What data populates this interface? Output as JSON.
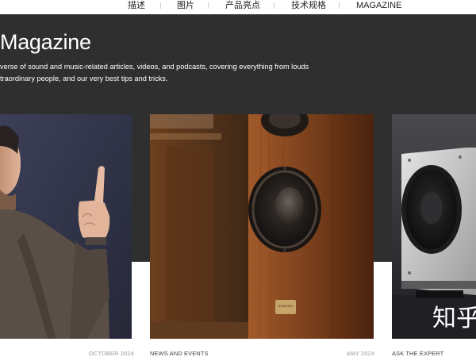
{
  "nav": {
    "items": [
      {
        "label": "描述"
      },
      {
        "label": "图片"
      },
      {
        "label": "产品亮点"
      },
      {
        "label": "技术规格"
      },
      {
        "label": "MAGAZINE"
      }
    ]
  },
  "magazine": {
    "title": "Magazine",
    "description_lines": [
      "verse of sound and music-related articles, videos, and podcasts, covering everything from louds",
      "traordinary people, and our very best tips and tricks."
    ]
  },
  "articles": [
    {
      "date": "OCTOBER 2024",
      "category": ""
    },
    {
      "date": "",
      "category": "NEWS AND EVENTS"
    },
    {
      "date": "MAY 2024",
      "category": "ASK THE EXPERT"
    }
  ],
  "overlays": {
    "speaker_badge": "DYNAUDIO",
    "watermark": "知乎"
  },
  "colors": {
    "band": "#2f2f2f",
    "wood": "#8a4a22"
  }
}
